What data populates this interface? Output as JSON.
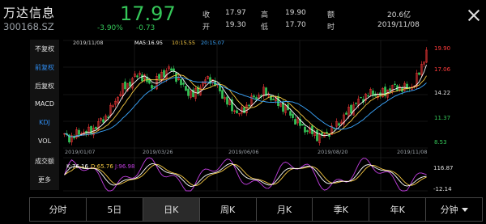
{
  "stock": {
    "name": "万达信息",
    "code": "300168.SZ",
    "price": "17.97",
    "change_pct": "-3.90%",
    "change_abs": "-0.73"
  },
  "stats": {
    "close_label": "收",
    "close_value": "17.97",
    "high_label": "高",
    "high_value": "19.90",
    "amount_label": "额",
    "amount_value": "20.6亿",
    "open_label": "开",
    "open_value": "19.30",
    "low_label": "低",
    "low_value": "17.70",
    "time_label": "时",
    "time_value": "2019/11/08"
  },
  "side_menu": [
    {
      "label": "不复权",
      "active": false
    },
    {
      "label": "前复权",
      "active": true
    },
    {
      "label": "后复权",
      "active": false
    },
    {
      "label": "MACD",
      "active": false
    },
    {
      "label": "KDJ",
      "active": true
    },
    {
      "label": "VOL",
      "active": false
    },
    {
      "label": "成交额",
      "active": false
    },
    {
      "label": "更多",
      "active": false
    }
  ],
  "main_chart": {
    "date_label": "2019/11/08",
    "ma_legend": [
      {
        "text": "MA5:16.95",
        "color": "#ffffff"
      },
      {
        "text": "10:15.55",
        "color": "#f5c842"
      },
      {
        "text": "20:15.07",
        "color": "#3ba7ff"
      }
    ],
    "y_ticks": [
      {
        "value": "19.90",
        "color": "#ff3b3b"
      },
      {
        "value": "17.06",
        "color": "#ff3b3b"
      },
      {
        "value": "14.22",
        "color": "#e0e0e0"
      },
      {
        "value": "11.37",
        "color": "#35c759"
      },
      {
        "value": "8.53",
        "color": "#35c759"
      }
    ],
    "x_ticks": [
      "2019/01/07",
      "2019/03/26",
      "2019/06/06",
      "2019/08/20",
      "2019/11/08"
    ],
    "y_range": [
      8.53,
      19.9
    ]
  },
  "kdj": {
    "legend": [
      {
        "text": "K:76.16",
        "color": "#ffffff"
      },
      {
        "text": "D:65.76",
        "color": "#f5c842"
      },
      {
        "text": "J:96.98",
        "color": "#c23ee0"
      }
    ],
    "y_ticks": [
      "116.87",
      "-12.14"
    ]
  },
  "chart_data": {
    "type": "candlestick",
    "title": "",
    "x_ticks": [
      "2019/01/07",
      "2019/03/26",
      "2019/06/06",
      "2019/08/20",
      "2019/11/08"
    ],
    "ylim": [
      8.53,
      19.9
    ],
    "close_series": [
      9.8,
      9.6,
      9.9,
      10.3,
      10.1,
      10.6,
      11.2,
      11.8,
      12.6,
      13.9,
      14.8,
      15.3,
      16.0,
      16.4,
      15.6,
      15.0,
      15.8,
      16.5,
      16.9,
      16.3,
      15.2,
      14.6,
      14.0,
      14.8,
      15.6,
      15.9,
      15.1,
      14.2,
      13.2,
      12.6,
      12.1,
      12.8,
      13.6,
      14.0,
      14.4,
      14.1,
      13.5,
      13.1,
      12.6,
      11.8,
      11.2,
      10.6,
      10.3,
      9.9,
      9.7,
      10.1,
      10.6,
      11.2,
      11.9,
      12.7,
      13.3,
      13.8,
      14.2,
      14.3,
      14.1,
      14.5,
      14.9,
      15.0,
      14.8,
      14.9,
      15.3,
      17.0,
      18.7
    ],
    "ma_lines": [
      "MA5",
      "MA10",
      "MA20"
    ],
    "kdj_lines": [
      "K",
      "D",
      "J"
    ]
  },
  "tabs": [
    {
      "label": "分时",
      "active": false,
      "dropdown": false
    },
    {
      "label": "5日",
      "active": false,
      "dropdown": false
    },
    {
      "label": "日K",
      "active": true,
      "dropdown": false
    },
    {
      "label": "周K",
      "active": false,
      "dropdown": false
    },
    {
      "label": "月K",
      "active": false,
      "dropdown": false
    },
    {
      "label": "季K",
      "active": false,
      "dropdown": false
    },
    {
      "label": "年K",
      "active": false,
      "dropdown": false
    },
    {
      "label": "分钟",
      "active": false,
      "dropdown": true
    }
  ]
}
